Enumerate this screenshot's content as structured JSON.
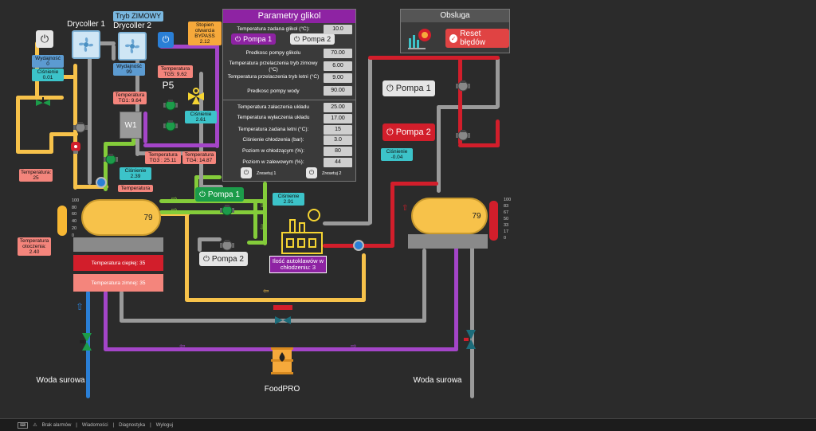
{
  "left": {
    "drycooler1_label": "Drycoller 1",
    "drycooler2_label": "Drycoller 2",
    "mode_badge": "Tryb ZIMOWY",
    "bypass_tag": "Stopien otwarcia BYPASS 2.12",
    "wydajnosc1": "Wydajność 0",
    "cisnienie1": "Ciśnienie 0.01",
    "wydajnosc2": "Wydajność 99",
    "temp_tg5": "Temperatura TG5: 9.62",
    "p5_label": "P5",
    "temp_tg1": "Temperatura TG1: 9.64",
    "cisnienie_p5": "Ciśnienie 2.61",
    "w1_label": "W1",
    "temp_tg3": "Temperatura TG3 : 25.11",
    "temp_tg4": "Temperatura TG4: 14.87",
    "cisnienie_w1": "Ciśnienie 2.39",
    "temperatura_left": "Temperatura: 25",
    "temperatura_tag2": "Temperatura",
    "temp_otoczenia": "Temperatura otoczenia: 2.40",
    "tank_value": "79",
    "scale": [
      "100",
      "80",
      "60",
      "40",
      "20",
      "0"
    ],
    "temp_ciepla": "Temperatura ciepłej: 35",
    "temp_zimnej": "Temperatura zimnej: 35",
    "woda_surowa": "Woda surowa"
  },
  "center": {
    "pompa1": "Pompa 1",
    "pompa2": "Pompa 2",
    "cisnienie": "Ciśnienie 2.91",
    "autoklawy": "Ilość autoklawów w chłodzeniu: 3",
    "foodpro": "FoodPRO"
  },
  "params": {
    "title": "Parametry glikol",
    "pompa1": "Pompa 1",
    "pompa2": "Pompa 2",
    "rows": [
      {
        "label": "Temperatura zadana glikol (°C):",
        "value": "10.0"
      },
      {
        "label": "Predkosc pompy glikolu",
        "value": "70.00"
      },
      {
        "label": "Temperatura przelaczenia tryb zimowy (°C)",
        "value": "6.00"
      },
      {
        "label": "Temperatura przelaczenia tryb letni (°C)",
        "value": "9.00"
      },
      {
        "label": "Predkosc pompy wody",
        "value": "90.00"
      },
      {
        "label": "Temperatura załaczenia układu",
        "value": "25.00"
      },
      {
        "label": "Temperatura wyłaczenia układu",
        "value": "17.00"
      },
      {
        "label": "Temperatura zadana letni (°C):",
        "value": "15"
      },
      {
        "label": "Ciśnienie chłodzenia (bar):",
        "value": "3.0"
      },
      {
        "label": "Poziom w chłodzącym (%):",
        "value": "80"
      },
      {
        "label": "Poziom w zalewowym (%):",
        "value": "44"
      }
    ],
    "zresetuj1": "Zresetuj 1",
    "zresetuj2": "Zresetuj 2"
  },
  "obsluga": {
    "title": "Obsluga",
    "reset": "Reset błędów"
  },
  "right": {
    "pompa1": "Pompa 1",
    "pompa2": "Pompa 2",
    "cisnienie": "Ciśnienie -0.04",
    "tank_value": "79",
    "scale": [
      "100",
      "83",
      "67",
      "50",
      "33",
      "17",
      "0"
    ],
    "woda_surowa": "Woda surowa"
  },
  "statusbar": {
    "brak_alarmow": "Brak alarmów",
    "wiadomosci": "Wiadomości",
    "diagnostyka": "Diagnostyka",
    "wyloguj": "Wyloguj"
  },
  "colors": {
    "glycol_purple": "#8e23a3",
    "pump_green": "#1c9c4a",
    "pump_red": "#d21e2b",
    "tank_yellow": "#f7c24a"
  }
}
